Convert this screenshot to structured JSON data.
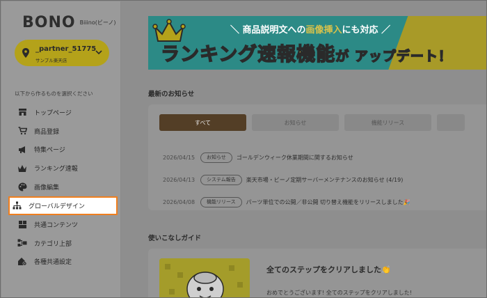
{
  "brand": {
    "logo": "BONO",
    "sub": "Biiino(ビーノ)"
  },
  "account": {
    "name": "_partner_51775",
    "shop": "サンプル楽天店"
  },
  "sidebar": {
    "hint": "以下から作るものを選択ください",
    "items": [
      {
        "label": "トップページ",
        "icon": "storefront-icon"
      },
      {
        "label": "商品登録",
        "icon": "cart-icon"
      },
      {
        "label": "特集ページ",
        "icon": "megaphone-icon"
      },
      {
        "label": "ランキング速報",
        "icon": "crown-icon"
      },
      {
        "label": "画像編集",
        "icon": "palette-icon"
      },
      {
        "label": "グローバルデザイン",
        "icon": "sitemap-icon"
      },
      {
        "label": "共通コンテンツ",
        "icon": "blocks-icon"
      },
      {
        "label": "カテゴリ上部",
        "icon": "category-icon"
      },
      {
        "label": "各種共通設定",
        "icon": "house-gear-icon"
      }
    ]
  },
  "banner": {
    "top_prefix": "＼ 商品説明文への",
    "top_highlight": "画像挿入",
    "top_suffix": "にも対応 ／",
    "main": "ランキング速報機能",
    "main_small": "が アップデート！"
  },
  "news": {
    "title": "最新のお知らせ",
    "tabs": [
      "すべて",
      "お知らせ",
      "機能リリース",
      ""
    ],
    "rows": [
      {
        "date": "2026/04/15",
        "badge": "お知らせ",
        "text": "ゴールデンウィーク休業期間に関するお知らせ"
      },
      {
        "date": "2026/04/13",
        "badge": "システム報告",
        "text": "楽天市場・ビーノ定期サーバーメンテナンスのお知らせ (4/19)"
      },
      {
        "date": "2026/04/08",
        "badge": "機能リリース",
        "text": "パーツ単位での公開／非公開 切り替え機能をリリースしました🎉"
      }
    ]
  },
  "guide": {
    "title": "使いこなしガイド",
    "card_title": "全てのステップをクリアしました👏",
    "card_text": "おめでとうございます! 全てのステップをクリアしました!"
  },
  "colors": {
    "accent": "#f07f1e",
    "brand_yellow": "#b4a21a",
    "tab_active": "#533e26"
  }
}
